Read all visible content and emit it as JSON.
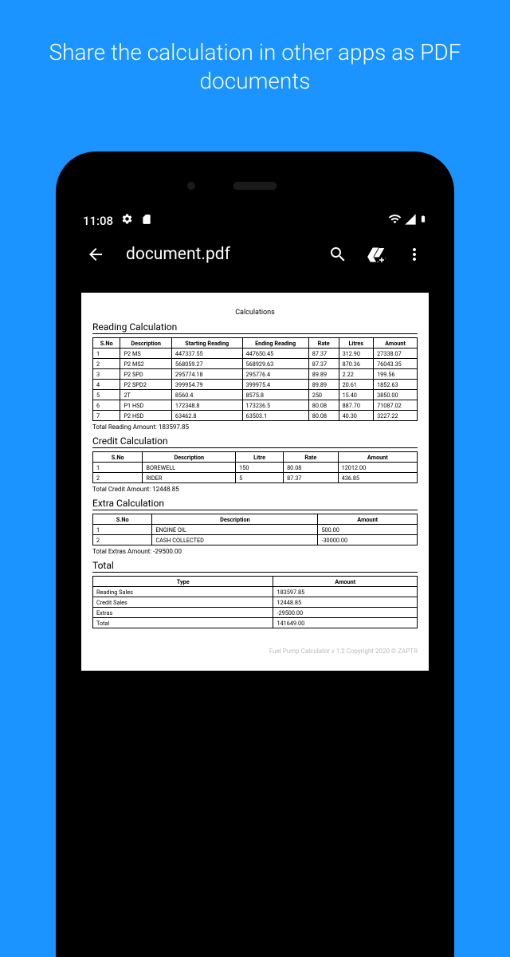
{
  "promo": "Share the calculation in other apps as PDF documents",
  "status": {
    "time": "11:08"
  },
  "appbar": {
    "title": "document.pdf"
  },
  "pdf": {
    "title": "Calculations",
    "reading": {
      "heading": "Reading Calculation",
      "headers": [
        "S.No",
        "Description",
        "Starting Reading",
        "Ending Reading",
        "Rate",
        "Litres",
        "Amount"
      ],
      "rows": [
        [
          "1",
          "P2 MS",
          "447337.55",
          "447650.45",
          "87.37",
          "312.90",
          "27338.07"
        ],
        [
          "2",
          "P2 MS2",
          "568059.27",
          "568929.63",
          "87.37",
          "870.36",
          "76043.35"
        ],
        [
          "3",
          "P2 SPD",
          "295774.18",
          "295776.4",
          "89.89",
          "2.22",
          "199.56"
        ],
        [
          "4",
          "P2 SPD2",
          "399954.79",
          "399975.4",
          "89.89",
          "20.61",
          "1852.63"
        ],
        [
          "5",
          "2T",
          "8560.4",
          "8575.8",
          "250",
          "15.40",
          "3850.00"
        ],
        [
          "6",
          "P1 HSD",
          "172348.8",
          "173236.5",
          "80.08",
          "887.70",
          "71087.02"
        ],
        [
          "7",
          "P2 HSD",
          "63462.8",
          "63503.1",
          "80.08",
          "40.30",
          "3227.22"
        ]
      ],
      "total": "Total Reading Amount: 183597.85"
    },
    "credit": {
      "heading": "Credit Calculation",
      "headers": [
        "S.No",
        "Description",
        "Litre",
        "Rate",
        "Amount"
      ],
      "rows": [
        [
          "1",
          "BOREWELL",
          "150",
          "80.08",
          "12012.00"
        ],
        [
          "2",
          "RIDER",
          "5",
          "87.37",
          "436.85"
        ]
      ],
      "total": "Total Credit Amount: 12448.85"
    },
    "extra": {
      "heading": "Extra Calculation",
      "headers": [
        "S.No",
        "Description",
        "Amount"
      ],
      "rows": [
        [
          "1",
          "ENGINE OIL",
          "500.00"
        ],
        [
          "2",
          "CASH COLLECTED",
          "-30000.00"
        ]
      ],
      "total": "Total Extras Amount: -29500.00"
    },
    "totals": {
      "heading": "Total",
      "headers": [
        "Type",
        "Amount"
      ],
      "rows": [
        [
          "Reading Sales",
          "183597.85"
        ],
        [
          "Credit Sales",
          "12448.85"
        ],
        [
          "Extras",
          "-29500.00"
        ],
        [
          "Total",
          "141649.00"
        ]
      ]
    },
    "footer": "Fuel Pump Calculator v 1.2 Copyright 2020 © ZAPTR"
  }
}
